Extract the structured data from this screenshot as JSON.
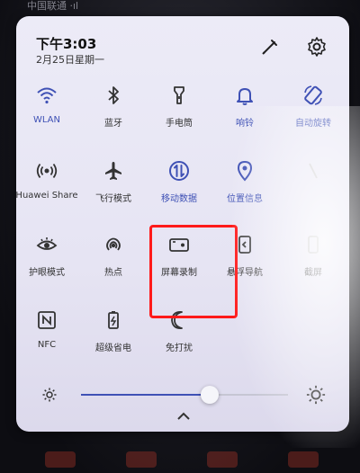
{
  "status_bar": {
    "carrier": "中国联通 ·ıl"
  },
  "header": {
    "time": "下午3:03",
    "date": "2月25日星期一",
    "edit_icon": "pencil-icon",
    "settings_icon": "gear-icon"
  },
  "tiles": [
    {
      "label": "WLAN",
      "icon": "wifi-icon",
      "state": "on"
    },
    {
      "label": "蓝牙",
      "icon": "bluetooth-icon",
      "state": "off"
    },
    {
      "label": "手电筒",
      "icon": "flashlight-icon",
      "state": "off"
    },
    {
      "label": "响铃",
      "icon": "bell-icon",
      "state": "on"
    },
    {
      "label": "自动旋转",
      "icon": "rotate-icon",
      "state": "on"
    },
    {
      "label": "Huawei Share",
      "icon": "share-icon",
      "state": "off"
    },
    {
      "label": "飞行模式",
      "icon": "airplane-icon",
      "state": "off"
    },
    {
      "label": "移动数据",
      "icon": "mobile-data-icon",
      "state": "on"
    },
    {
      "label": "位置信息",
      "icon": "location-icon",
      "state": "on"
    },
    {
      "label": "",
      "icon": "hotspot-partial-icon",
      "state": "faded"
    },
    {
      "label": "护眼模式",
      "icon": "eye-icon",
      "state": "off"
    },
    {
      "label": "热点",
      "icon": "hotspot-icon",
      "state": "off"
    },
    {
      "label": "屏幕录制",
      "icon": "screen-record-icon",
      "state": "off"
    },
    {
      "label": "悬浮导航",
      "icon": "float-nav-icon",
      "state": "off"
    },
    {
      "label": "截屏",
      "icon": "screenshot-icon",
      "state": "off"
    },
    {
      "label": "NFC",
      "icon": "nfc-icon",
      "state": "off"
    },
    {
      "label": "超级省电",
      "icon": "battery-saver-icon",
      "state": "off"
    },
    {
      "label": "免打扰",
      "icon": "moon-icon",
      "state": "off"
    }
  ],
  "brightness": {
    "level_fraction": 0.62,
    "low_icon": "sun-small-icon",
    "high_icon": "sun-large-icon"
  },
  "colors": {
    "accent": "#3f51b5",
    "highlight": "#ff1a1a"
  }
}
